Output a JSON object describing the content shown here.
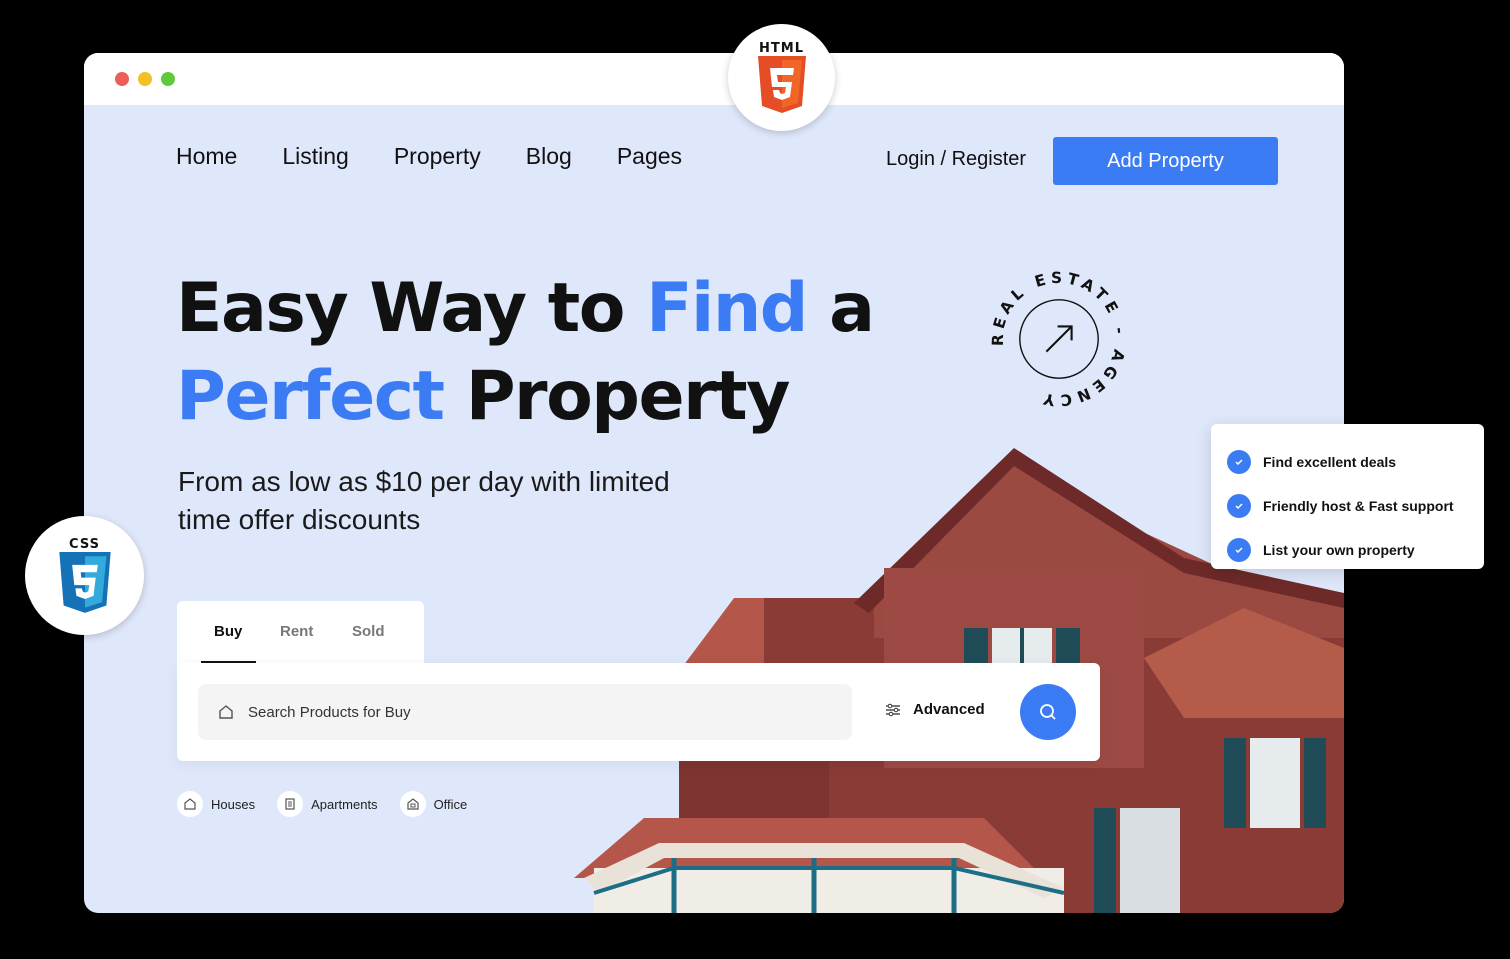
{
  "nav": {
    "items": [
      {
        "label": "Home"
      },
      {
        "label": "Listing"
      },
      {
        "label": "Property"
      },
      {
        "label": "Blog"
      },
      {
        "label": "Pages"
      }
    ],
    "login_label": "Login / Register",
    "add_property_label": "Add Property"
  },
  "hero": {
    "line1_a": "Easy Way to ",
    "line1_b": "Find",
    "line1_c": " a",
    "line2_a": "Perfect",
    "line2_b": " Property",
    "subtitle": "From as low as $10 per day with limited time offer discounts"
  },
  "circle_badge": {
    "text": "REAL ESTATE - AGENCY"
  },
  "search": {
    "tabs": [
      {
        "label": "Buy"
      },
      {
        "label": "Rent"
      },
      {
        "label": "Sold"
      }
    ],
    "placeholder": "Search Products for Buy",
    "advanced_label": "Advanced"
  },
  "categories": [
    {
      "label": "Houses",
      "icon": "house-icon"
    },
    {
      "label": "Apartments",
      "icon": "apartment-icon"
    },
    {
      "label": "Office",
      "icon": "office-icon"
    }
  ],
  "badges": {
    "html": "HTML",
    "css": "CSS"
  },
  "features": [
    {
      "label": "Find excellent deals"
    },
    {
      "label": "Friendly host & Fast support"
    },
    {
      "label": "List your own property"
    }
  ],
  "colors": {
    "accent": "#3b7cf5",
    "background": "#dfe8fb"
  }
}
